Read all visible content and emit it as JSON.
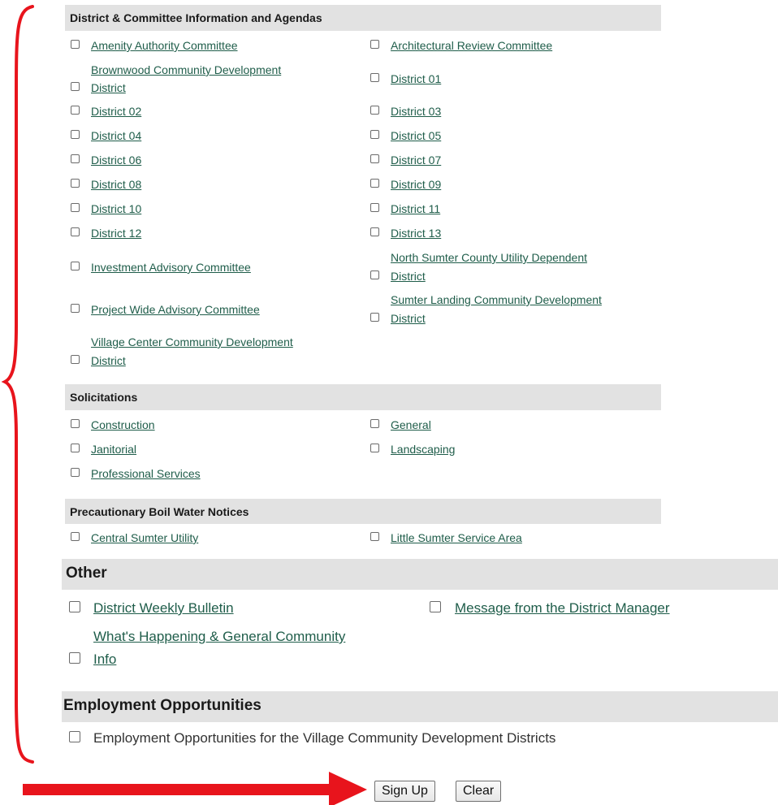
{
  "sections": {
    "district": {
      "title": "District & Committee Information and Agendas",
      "items": [
        "Amenity Authority Committee",
        "Architectural Review Committee",
        "Brownwood Community Development",
        "District",
        "District 01",
        "District 02",
        "District 03",
        "District 04",
        "District 05",
        "District 06",
        "District 07",
        "District 08",
        "District 09",
        "District 10",
        "District 11",
        "District 12",
        "District 13",
        "Investment Advisory Committee",
        "North Sumter County Utility Dependent",
        "District",
        "Project Wide Advisory Committee",
        "Sumter Landing Community Development",
        "District",
        "Village Center Community Development",
        "District"
      ]
    },
    "solicitations": {
      "title": "Solicitations",
      "items": [
        "Construction",
        "General",
        "Janitorial",
        "Landscaping",
        "Professional Services"
      ]
    },
    "boil": {
      "title": "Precautionary Boil Water Notices",
      "items": [
        "Central Sumter Utility",
        "Little Sumter Service Area"
      ]
    },
    "other": {
      "title": "Other",
      "items": [
        "District Weekly Bulletin",
        "Message from the District Manager",
        "What's Happening & General Community",
        "Info"
      ]
    },
    "employment": {
      "title": "Employment Opportunities",
      "items": [
        "Employment Opportunities for the Village Community Development Districts"
      ]
    }
  },
  "buttons": {
    "signup": "Sign Up",
    "clear": "Clear"
  },
  "annotation_color": "#e8141c"
}
